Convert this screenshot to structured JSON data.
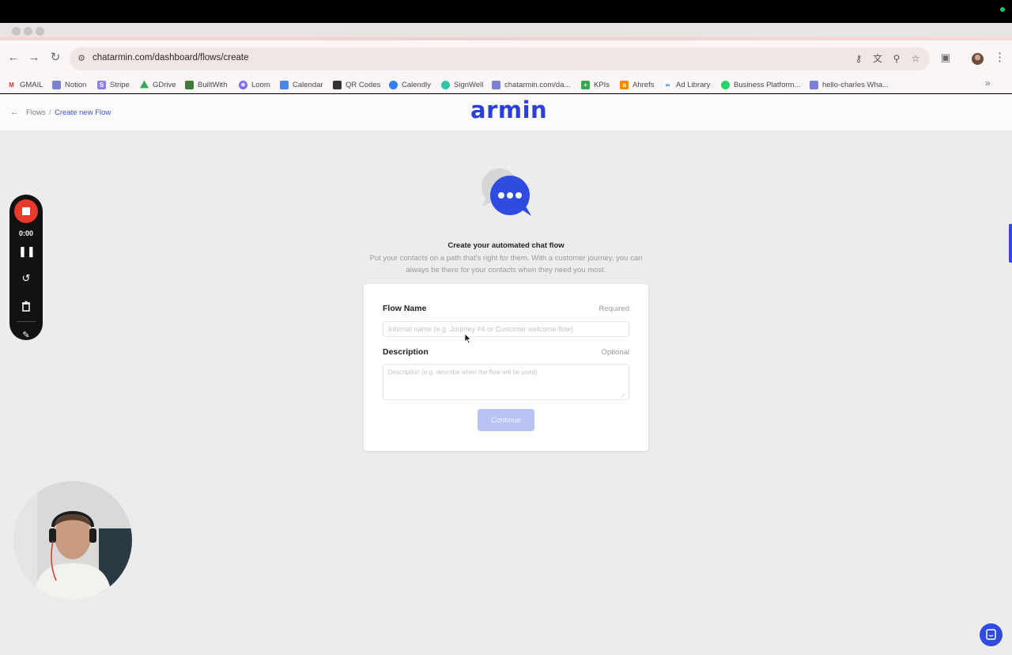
{
  "browser": {
    "url": "chatarmin.com/dashboard/flows/create",
    "bookmarks": [
      {
        "label": "GMAIL",
        "icon": "gmail-icon",
        "color": "#d93025"
      },
      {
        "label": "Notion",
        "icon": "notion-icon",
        "color": "#7b82d6"
      },
      {
        "label": "Stripe",
        "icon": "stripe-icon",
        "color": "#8f7ee8"
      },
      {
        "label": "GDrive",
        "icon": "gdrive-icon",
        "color": "#34a853"
      },
      {
        "label": "BuiltWith",
        "icon": "builtwith-icon",
        "color": "#3f7a3a"
      },
      {
        "label": "Loom",
        "icon": "loom-icon",
        "color": "#7b68ee"
      },
      {
        "label": "Calendar",
        "icon": "calendar-icon",
        "color": "#4a86e8"
      },
      {
        "label": "QR Codes",
        "icon": "qr-code-icon",
        "color": "#333333"
      },
      {
        "label": "Calendly",
        "icon": "calendly-icon",
        "color": "#2f80ed"
      },
      {
        "label": "SignWell",
        "icon": "signwell-icon",
        "color": "#2ec4a6"
      },
      {
        "label": "chatarmin.com/da...",
        "icon": "chatarmin-icon",
        "color": "#7b82d6"
      },
      {
        "label": "KPIs",
        "icon": "sheets-icon",
        "color": "#34a853"
      },
      {
        "label": "Ahrefs",
        "icon": "ahrefs-icon",
        "color": "#ff8800"
      },
      {
        "label": "Ad Library",
        "icon": "meta-icon",
        "color": "#1877f2"
      },
      {
        "label": "Business Platform...",
        "icon": "whatsapp-icon",
        "color": "#25d366"
      },
      {
        "label": "hello-charles Wha...",
        "icon": "hello-charles-icon",
        "color": "#7b82d6"
      }
    ]
  },
  "header": {
    "breadcrumb_root": "Flows",
    "breadcrumb_separator": "/",
    "breadcrumb_current": "Create new Flow",
    "logo": "armin"
  },
  "hero": {
    "title": "Create your automated chat flow",
    "description": "Put your contacts on a path that's right for them. With a customer journey, you can always be there for your contacts when they need you most."
  },
  "form": {
    "flow_name_label": "Flow Name",
    "flow_name_hint": "Required",
    "flow_name_placeholder": "Internal name (e.g. Journey #4 or Customer welcome flow)",
    "description_label": "Description",
    "description_hint": "Optional",
    "description_placeholder": "Description (e.g. describe when the flow will be used)",
    "continue_label": "Continue"
  },
  "recorder": {
    "time": "0:00"
  },
  "colors": {
    "brand": "#2a3fd9",
    "record": "#e8392c",
    "button_disabled": "#b9c2f4"
  }
}
